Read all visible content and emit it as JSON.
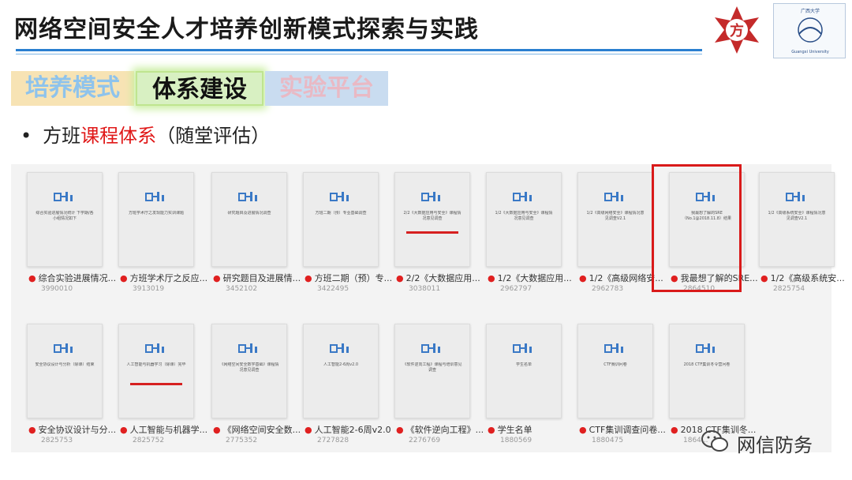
{
  "header": {
    "title": "网络空间安全人才培养创新模式探索与实践",
    "logo_right_top": "广西大学",
    "logo_right_bottom": "Guangxi University"
  },
  "tabs": [
    {
      "label": "培养模式"
    },
    {
      "label": "体系建设"
    },
    {
      "label": "实验平台"
    }
  ],
  "bullet": {
    "dot": "•",
    "prefix": "方班",
    "highlight": "课程体系",
    "suffix": "（随堂评估）"
  },
  "cards": [
    {
      "thumb_text": "综合实验进展情况统计\n下学期/各小组情况如下",
      "caption": "综合实验进展情况...",
      "count": "3990010"
    },
    {
      "thumb_text": "方班学术厅之发现能力实训课题",
      "caption": "方班学术厅之反应...",
      "count": "3913019"
    },
    {
      "thumb_text": "研究题目及进展情况调查",
      "caption": "研究题目及进展情...",
      "count": "3452102"
    },
    {
      "thumb_text": "方班二期（预）专业基础调查",
      "caption": "方班二期（预）专...",
      "count": "3422495"
    },
    {
      "thumb_text": "2/2《大数据应用与安全》课程情况意见调查",
      "caption": "2/2《大数据应用...",
      "count": "3038011"
    },
    {
      "thumb_text": "1/2《大数据应用与安全》课程情况意见调查",
      "caption": "1/2《大数据应用...",
      "count": "2962797"
    },
    {
      "thumb_text": "1/2《高级网络安全》课程情况意见调查V2.1",
      "caption": "1/2《高级网络安...",
      "count": "2962783"
    },
    {
      "thumb_text": "我最想了解的SRE（No.1@2018.11.8）结果",
      "caption": "我最想了解的SRE...",
      "count": "2864510"
    },
    {
      "thumb_text": "1/2《高级系统安全》课程情况意见调查V2.1",
      "caption": "1/2《高级系统安...",
      "count": "2825754"
    },
    {
      "thumb_text": "安全协议设计与分析（除课）结束",
      "caption": "安全协议设计与分...",
      "count": "2825753"
    },
    {
      "thumb_text": "人工智能与机器学习（除课）完毕",
      "caption": "人工智能与机器学...",
      "count": "2825752"
    },
    {
      "thumb_text": "《网络空间安全数学基础》课程情况意见调查",
      "caption": "《网络空间安全数...",
      "count": "2775352"
    },
    {
      "thumb_text": "人工智能2-6周v2.0",
      "caption": "人工智能2-6周v2.0",
      "count": "2727828"
    },
    {
      "thumb_text": "《软件逆向工程》课程与培训意见调查",
      "caption": "《软件逆向工程》...",
      "count": "2276769"
    },
    {
      "thumb_text": "学生名单",
      "caption": "学生名单",
      "count": "1880569"
    },
    {
      "thumb_text": "CTF赛训问卷",
      "caption": "CTF集训调查问卷...",
      "count": "1880475"
    },
    {
      "thumb_text": "2018 CTF集训冬令营问卷",
      "caption": "2018 CTF集训冬...",
      "count": "1864..."
    }
  ],
  "watermark": {
    "text": "网信防务"
  },
  "colors": {
    "accent_blue": "#2a7fd0",
    "highlight_red": "#d91a1a",
    "tab_active_green": "#d8f0c2"
  }
}
